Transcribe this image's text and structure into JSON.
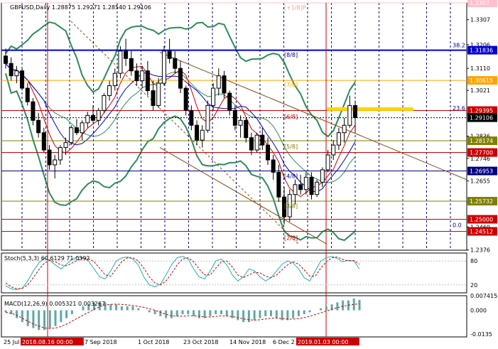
{
  "chart_data": {
    "type": "candlestick",
    "symbol": "GBPUSD,Daily",
    "ohlc_header": "1.28875 1.29271 1.28540 1.29106",
    "price_axis": {
      "range": [
        1.2375,
        1.3375
      ],
      "ticks": [
        "1.3307",
        "1.3206",
        "1.3110",
        "1.3021",
        "1.2926",
        "1.2836",
        "1.2746",
        "1.2655",
        "1.2570",
        "1.2469",
        "1.2376"
      ],
      "highlighted_levels": [
        {
          "label": "1.3307",
          "value": 1.3375,
          "color": "#ffc0cb",
          "text_color": "#ffffff"
        },
        {
          "label": "1.31836",
          "value": 1.31836,
          "color": "#0000cd",
          "text_color": "#ffffff"
        },
        {
          "label": "1.30615",
          "value": 1.30615,
          "color": "#ffa500",
          "text_color": "#ffffff"
        },
        {
          "label": "1.29395",
          "value": 1.29395,
          "color": "#cc0000",
          "text_color": "#ffffff"
        },
        {
          "label": "1.29106",
          "value": 1.29106,
          "color": "#000000",
          "text_color": "#ffffff"
        },
        {
          "label": "1.28174",
          "value": 1.28174,
          "color": "#808000",
          "text_color": "#ffffff"
        },
        {
          "label": "1.27700",
          "value": 1.277,
          "color": "#cc0000",
          "text_color": "#ffffff"
        },
        {
          "label": "1.26953",
          "value": 1.26953,
          "color": "#000080",
          "text_color": "#ffffff"
        },
        {
          "label": "1.25732",
          "value": 1.25732,
          "color": "#808000",
          "text_color": "#ffffff"
        },
        {
          "label": "1.25000",
          "value": 1.25,
          "color": "#cc0000",
          "text_color": "#ffffff"
        },
        {
          "label": "1.24512",
          "value": 1.24512,
          "color": "#cc0000",
          "text_color": "#ffffff"
        }
      ]
    },
    "murrey_labels": [
      {
        "text": "[+1/8]P",
        "value": 1.3356,
        "color": "#ff9999"
      },
      {
        "text": "[8/8]",
        "value": 1.3165,
        "color": "#000080"
      },
      {
        "text": "[7/8]",
        "value": 1.3045,
        "color": "#ffa500"
      },
      {
        "text": "[6/8]",
        "value": 1.2915,
        "color": "#cc0000"
      },
      {
        "text": "[5/8]",
        "value": 1.2795,
        "color": "#808000"
      },
      {
        "text": "[4/8]",
        "value": 1.2675,
        "color": "#000080"
      },
      {
        "text": "[3/8]",
        "value": 1.2555,
        "color": "#808000"
      },
      {
        "text": "[2/8]",
        "value": 1.2425,
        "color": "#cc0000"
      }
    ],
    "fibo_labels": [
      {
        "text": "38.2",
        "value": 1.3192
      },
      {
        "text": "23.6",
        "value": 1.2938
      },
      {
        "text": "0.0",
        "value": 1.2465
      }
    ],
    "x_axis_labels": [
      "25 Jul 2018",
      "2018.08.16 00:00",
      "7 Sep 2018",
      "1 Oct 2018",
      "23 Oct 2018",
      "14 Nov 2018",
      "6 Dec 2",
      "2019.01.03 00:00"
    ],
    "stoch": {
      "label": "Stoch(5,3,3) 60.6129 71.0392",
      "range": [
        0,
        100
      ],
      "levels": [
        "80",
        "20"
      ],
      "k": [
        18,
        10,
        8,
        12,
        30,
        55,
        75,
        88,
        82,
        70,
        60,
        72,
        85,
        90,
        88,
        80,
        60,
        40,
        35,
        55,
        80,
        88,
        90,
        85,
        70,
        40,
        20,
        15,
        22,
        45,
        70,
        88,
        92,
        85,
        60,
        40,
        35,
        55,
        80,
        85,
        70,
        45,
        30,
        40,
        60,
        55,
        40,
        30,
        38,
        55,
        72,
        80,
        75,
        60,
        38,
        30,
        55,
        80,
        88,
        92,
        86,
        78,
        82,
        80,
        60
      ],
      "d": [
        25,
        15,
        10,
        11,
        20,
        38,
        58,
        75,
        82,
        78,
        70,
        68,
        75,
        82,
        88,
        86,
        78,
        62,
        45,
        42,
        60,
        78,
        88,
        88,
        80,
        62,
        40,
        25,
        20,
        30,
        48,
        70,
        85,
        88,
        78,
        60,
        45,
        45,
        62,
        78,
        80,
        65,
        45,
        38,
        45,
        52,
        50,
        42,
        38,
        45,
        58,
        70,
        78,
        72,
        58,
        42,
        42,
        62,
        78,
        88,
        90,
        84,
        80,
        81,
        72
      ]
    },
    "macd": {
      "label": "MACD(12,26,9) 0.005321 0.003267",
      "range": [
        -0.0135,
        0.0074
      ],
      "ticks": [
        "0.007415",
        "0.000",
        "-0.0135"
      ],
      "hist": [
        -0.001,
        -0.002,
        -0.004,
        -0.006,
        -0.008,
        -0.009,
        -0.01,
        -0.01,
        -0.009,
        -0.008,
        -0.006,
        -0.004,
        -0.002,
        0.0,
        0.002,
        0.003,
        0.004,
        0.004,
        0.004,
        0.003,
        0.003,
        0.002,
        0.002,
        0.002,
        0.001,
        0.0,
        -0.001,
        -0.002,
        -0.003,
        -0.004,
        -0.004,
        -0.003,
        -0.002,
        -0.002,
        -0.003,
        -0.004,
        -0.004,
        -0.003,
        -0.002,
        -0.002,
        -0.003,
        -0.004,
        -0.005,
        -0.006,
        -0.006,
        -0.005,
        -0.004,
        -0.003,
        -0.003,
        -0.004,
        -0.005,
        -0.005,
        -0.004,
        -0.003,
        -0.002,
        -0.001,
        0.0,
        0.001,
        0.002,
        0.003,
        0.004,
        0.005,
        0.005,
        0.006,
        0.0053
      ],
      "signal": [
        -0.001,
        -0.0015,
        -0.0025,
        -0.004,
        -0.0055,
        -0.007,
        -0.008,
        -0.009,
        -0.0092,
        -0.009,
        -0.0082,
        -0.007,
        -0.0055,
        -0.004,
        -0.0025,
        -0.001,
        0.0005,
        0.0018,
        0.0027,
        0.003,
        0.0031,
        0.003,
        0.0027,
        0.0024,
        0.002,
        0.0015,
        0.0008,
        0.0,
        -0.001,
        -0.002,
        -0.0028,
        -0.003,
        -0.003,
        -0.0028,
        -0.0028,
        -0.003,
        -0.0034,
        -0.0034,
        -0.0031,
        -0.0028,
        -0.0029,
        -0.0032,
        -0.0037,
        -0.0043,
        -0.0048,
        -0.005,
        -0.0048,
        -0.0044,
        -0.004,
        -0.004,
        -0.0042,
        -0.0045,
        -0.0045,
        -0.0042,
        -0.0037,
        -0.003,
        -0.0022,
        -0.0013,
        -0.0004,
        0.0005,
        0.0013,
        0.002,
        0.0026,
        0.003,
        0.0033
      ]
    },
    "candles": [
      [
        1.316,
        1.319,
        1.311,
        1.313
      ],
      [
        1.313,
        1.3155,
        1.306,
        1.308
      ],
      [
        1.308,
        1.312,
        1.305,
        1.31
      ],
      [
        1.31,
        1.311,
        1.302,
        1.303
      ],
      [
        1.303,
        1.305,
        1.296,
        1.2975
      ],
      [
        1.2975,
        1.299,
        1.288,
        1.29
      ],
      [
        1.29,
        1.293,
        1.283,
        1.285
      ],
      [
        1.285,
        1.287,
        1.277,
        1.278
      ],
      [
        1.278,
        1.28,
        1.27,
        1.272
      ],
      [
        1.272,
        1.276,
        1.2665,
        1.274
      ],
      [
        1.274,
        1.28,
        1.272,
        1.279
      ],
      [
        1.279,
        1.283,
        1.276,
        1.281
      ],
      [
        1.281,
        1.288,
        1.28,
        1.287
      ],
      [
        1.287,
        1.2905,
        1.284,
        1.285
      ],
      [
        1.285,
        1.29,
        1.282,
        1.289
      ],
      [
        1.289,
        1.2935,
        1.287,
        1.292
      ],
      [
        1.292,
        1.296,
        1.289,
        1.29
      ],
      [
        1.29,
        1.295,
        1.288,
        1.294
      ],
      [
        1.294,
        1.301,
        1.293,
        1.3
      ],
      [
        1.3,
        1.306,
        1.298,
        1.304
      ],
      [
        1.304,
        1.311,
        1.302,
        1.309
      ],
      [
        1.309,
        1.32,
        1.307,
        1.318
      ],
      [
        1.318,
        1.323,
        1.312,
        1.315
      ],
      [
        1.315,
        1.318,
        1.308,
        1.31
      ],
      [
        1.31,
        1.313,
        1.304,
        1.306
      ],
      [
        1.306,
        1.312,
        1.303,
        1.31
      ],
      [
        1.31,
        1.314,
        1.3,
        1.302
      ],
      [
        1.302,
        1.306,
        1.294,
        1.296
      ],
      [
        1.296,
        1.307,
        1.295,
        1.305
      ],
      [
        1.305,
        1.32,
        1.304,
        1.318
      ],
      [
        1.318,
        1.323,
        1.313,
        1.315
      ],
      [
        1.315,
        1.318,
        1.309,
        1.311
      ],
      [
        1.311,
        1.314,
        1.301,
        1.303
      ],
      [
        1.303,
        1.304,
        1.292,
        1.294
      ],
      [
        1.294,
        1.296,
        1.286,
        1.288
      ],
      [
        1.288,
        1.29,
        1.28,
        1.282
      ],
      [
        1.282,
        1.288,
        1.279,
        1.286
      ],
      [
        1.286,
        1.298,
        1.285,
        1.296
      ],
      [
        1.296,
        1.305,
        1.294,
        1.303
      ],
      [
        1.303,
        1.311,
        1.3,
        1.308
      ],
      [
        1.308,
        1.31,
        1.299,
        1.301
      ],
      [
        1.301,
        1.302,
        1.292,
        1.294
      ],
      [
        1.294,
        1.296,
        1.286,
        1.288
      ],
      [
        1.288,
        1.292,
        1.283,
        1.29
      ],
      [
        1.29,
        1.291,
        1.281,
        1.283
      ],
      [
        1.283,
        1.285,
        1.276,
        1.278
      ],
      [
        1.278,
        1.285,
        1.277,
        1.284
      ],
      [
        1.284,
        1.287,
        1.278,
        1.28
      ],
      [
        1.28,
        1.283,
        1.272,
        1.274
      ],
      [
        1.274,
        1.276,
        1.266,
        1.269
      ],
      [
        1.269,
        1.272,
        1.257,
        1.259
      ],
      [
        1.259,
        1.263,
        1.248,
        1.251
      ],
      [
        1.251,
        1.262,
        1.249,
        1.26
      ],
      [
        1.26,
        1.266,
        1.256,
        1.264
      ],
      [
        1.264,
        1.268,
        1.26,
        1.262
      ],
      [
        1.262,
        1.269,
        1.26,
        1.267
      ],
      [
        1.267,
        1.269,
        1.258,
        1.26
      ],
      [
        1.26,
        1.266,
        1.259,
        1.265
      ],
      [
        1.265,
        1.271,
        1.263,
        1.27
      ],
      [
        1.27,
        1.278,
        1.269,
        1.276
      ],
      [
        1.276,
        1.282,
        1.274,
        1.28
      ],
      [
        1.28,
        1.287,
        1.278,
        1.285
      ],
      [
        1.285,
        1.291,
        1.281,
        1.288
      ],
      [
        1.288,
        1.3,
        1.287,
        1.296
      ],
      [
        1.296,
        1.298,
        1.2854,
        1.2911
      ]
    ]
  }
}
